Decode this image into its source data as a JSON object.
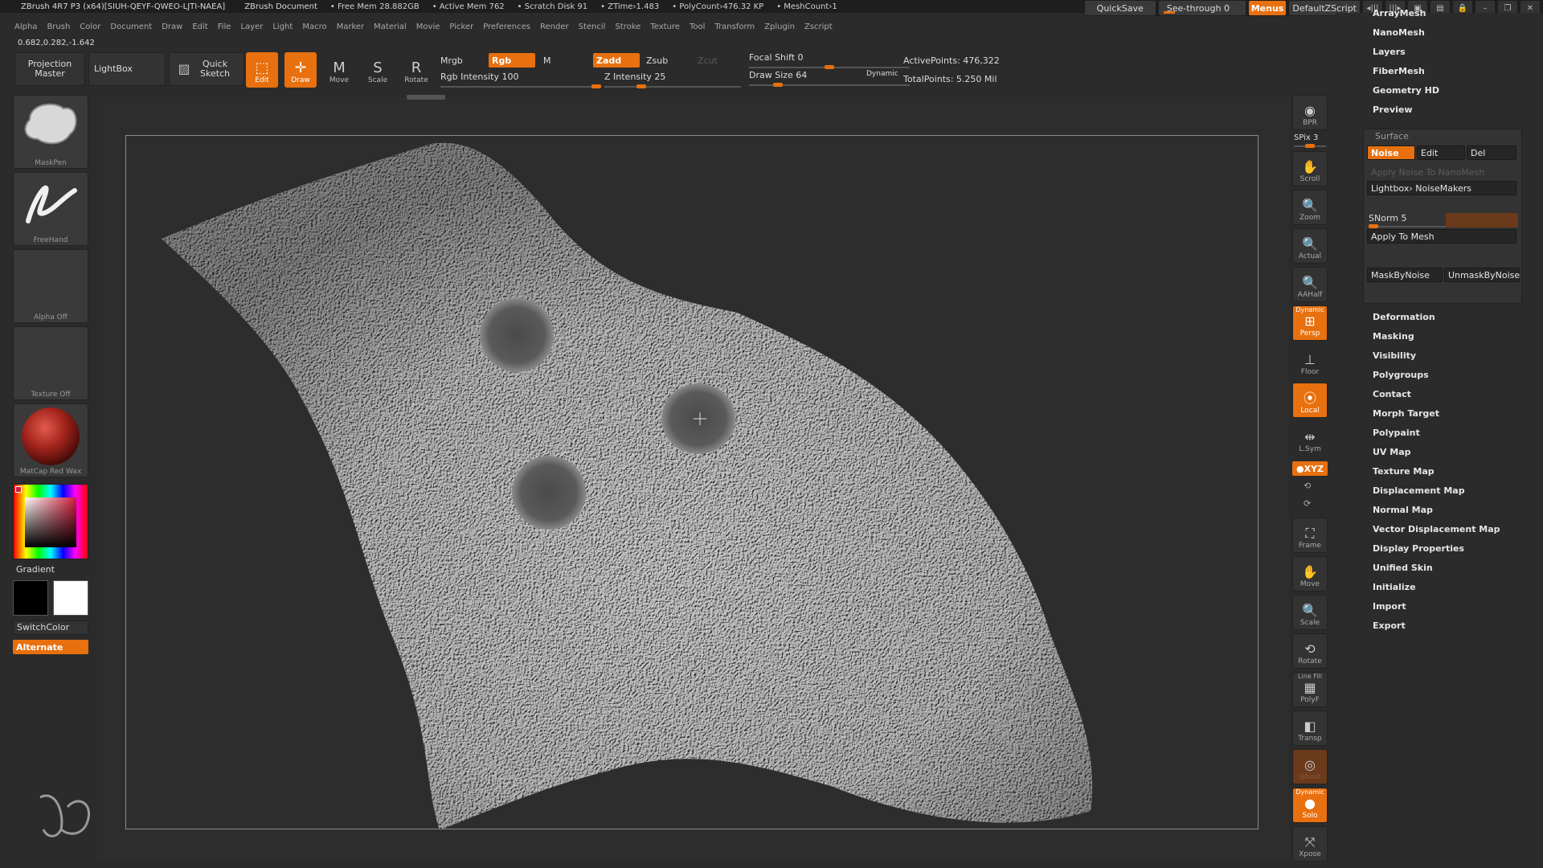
{
  "titlebar": {
    "app": "ZBrush 4R7 P3 (x64)[SIUH-QEYF-QWEO-LJTI-NAEA]",
    "doc": "ZBrush Document",
    "stats": [
      "Free Mem 28.882GB",
      "Active Mem 762",
      "Scratch Disk 91",
      "ZTime›1.483",
      "PolyCount›476.32 KP",
      "MeshCount›1"
    ],
    "quicksave": "QuickSave",
    "seethrough": "See-through   0",
    "menus": "Menus",
    "script": "DefaultZScript"
  },
  "menubar": [
    "Alpha",
    "Brush",
    "Color",
    "Document",
    "Draw",
    "Edit",
    "File",
    "Layer",
    "Light",
    "Macro",
    "Marker",
    "Material",
    "Movie",
    "Picker",
    "Preferences",
    "Render",
    "Stencil",
    "Stroke",
    "Texture",
    "Tool",
    "Transform",
    "Zplugin",
    "Zscript"
  ],
  "coords": "0.682,0.282,-1.642",
  "toolbar": {
    "projection_master": "Projection Master",
    "lightbox": "LightBox",
    "quick_sketch": "Quick Sketch",
    "edit": "Edit",
    "draw": "Draw",
    "move": "Move",
    "scale": "Scale",
    "rotate": "Rotate",
    "mrgb": "Mrgb",
    "rgb": "Rgb",
    "m": "M",
    "rgb_intensity": "Rgb Intensity 100",
    "zadd": "Zadd",
    "zsub": "Zsub",
    "zcut": "Zcut",
    "z_intensity": "Z Intensity 25",
    "focal_shift": "Focal Shift 0",
    "draw_size": "Draw Size 64",
    "dynamic": "Dynamic",
    "active_points": "ActivePoints: 476,322",
    "total_points": "TotalPoints: 5.250 Mil",
    "rgb_intensity_value": 100,
    "z_intensity_value": 25,
    "draw_size_value": 64,
    "focal_shift_value": 0
  },
  "left": {
    "brush": "MaskPen",
    "stroke": "FreeHand",
    "alpha": "Alpha Off",
    "texture": "Texture Off",
    "material": "MatCap Red Wax",
    "gradient": "Gradient",
    "switchcolor": "SwitchColor",
    "alternate": "Alternate",
    "main_color": "#d11d3a"
  },
  "shelf": {
    "bpr": "BPR",
    "spix": "SPix 3",
    "scroll": "Scroll",
    "zoom": "Zoom",
    "actual": "Actual",
    "aahalf": "AAHalf",
    "dynamic": "Dynamic",
    "persp": "Persp",
    "floor": "Floor",
    "local": "Local",
    "lsym": "L.Sym",
    "xyz": "●XYZ",
    "frame": "Frame",
    "move": "Move",
    "scale": "Scale",
    "rotate": "Rotate",
    "linefill": "Line Fill",
    "polyf": "PolyF",
    "transp": "Transp",
    "ghost": "Ghost",
    "solo_dynamic": "Dynamic",
    "solo": "Solo",
    "xpose": "Xpose"
  },
  "tool_palette": {
    "top_items": [
      "ArrayMesh",
      "NanoMesh",
      "Layers",
      "FiberMesh",
      "Geometry HD",
      "Preview"
    ],
    "surface": {
      "header": "Surface",
      "noise": "Noise",
      "edit": "Edit",
      "del": "Del",
      "apply_noise_nanomesh": "Apply Noise To NanoMesh",
      "lightbox_noisemakers": "Lightbox› NoiseMakers",
      "snorm": "SNorm 5",
      "apply_to_mesh": "Apply To Mesh",
      "maskbynoise": "MaskByNoise",
      "unmaskbynoise": "UnmaskByNoise",
      "snorm_value": 5
    },
    "bottom_items": [
      "Deformation",
      "Masking",
      "Visibility",
      "Polygroups",
      "Contact",
      "Morph Target",
      "Polypaint",
      "UV Map",
      "Texture Map",
      "Displacement Map",
      "Normal Map",
      "Vector Displacement Map",
      "Display Properties",
      "Unified Skin",
      "Initialize",
      "Import",
      "Export"
    ]
  },
  "colors": {
    "accent": "#e8700e",
    "background": "#2b2b2b",
    "panel": "#333333",
    "mesh": "#bdbdbd"
  }
}
